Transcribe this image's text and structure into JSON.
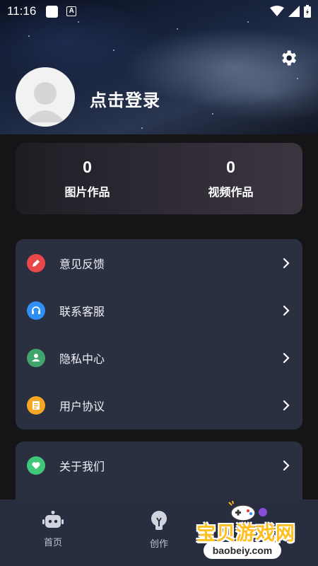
{
  "status_bar": {
    "time": "11:16",
    "notification_icon": "a-notification-icon"
  },
  "header": {
    "login_label": "点击登录",
    "settings_icon": "gear-icon",
    "avatar_icon": "default-avatar"
  },
  "stats": [
    {
      "value": "0",
      "label": "图片作品"
    },
    {
      "value": "0",
      "label": "视频作品"
    }
  ],
  "menu": {
    "group1": [
      {
        "label": "意见反馈",
        "icon": "pencil-icon",
        "color": "#e8484a"
      },
      {
        "label": "联系客服",
        "icon": "headset-icon",
        "color": "#2f8ff5"
      },
      {
        "label": "隐私中心",
        "icon": "shield-user-icon",
        "color": "#3fa56c"
      },
      {
        "label": "用户协议",
        "icon": "document-icon",
        "color": "#f5a623"
      }
    ],
    "group2": [
      {
        "label": "关于我们",
        "icon": "heart-icon",
        "color": "#3fc77a"
      }
    ]
  },
  "tabbar": {
    "tabs": [
      {
        "label": "首页",
        "icon": "robot-icon"
      },
      {
        "label": "创作",
        "icon": "bulb-icon"
      }
    ]
  },
  "watermark": {
    "text": "宝贝游戏网",
    "domain": "baobeiy.com"
  },
  "colors": {
    "background": "#151517",
    "card": "#2a3040",
    "tabbar": "#282d40",
    "accent_watermark": "#ffbf1e"
  }
}
